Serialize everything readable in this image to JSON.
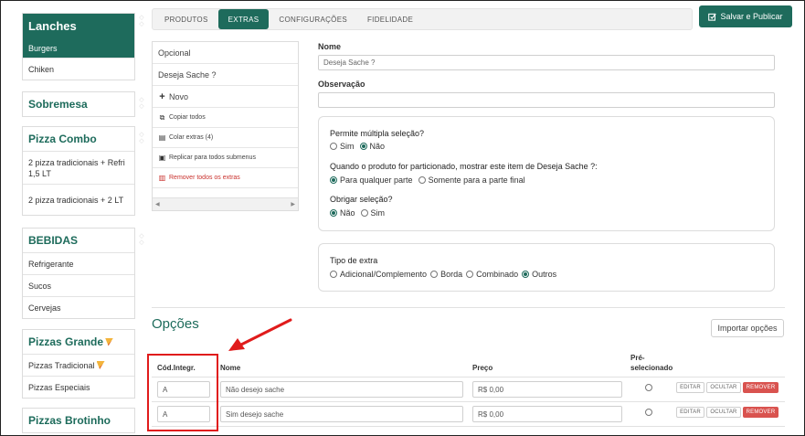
{
  "sidebar": {
    "categories": [
      {
        "name": "Lanches",
        "items": [
          "Burgers",
          "Chiken"
        ]
      },
      {
        "name": "Sobremesa",
        "items": []
      },
      {
        "name": "Pizza Combo",
        "items": [
          "2 pizza tradicionais + Refri 1,5 LT",
          "2 pizza tradicionais + 2 LT"
        ]
      },
      {
        "name": "BEBIDAS",
        "items": [
          "Refrigerante",
          "Sucos",
          "Cervejas"
        ]
      },
      {
        "name": "Pizzas Grande",
        "items": [
          "Pizzas Tradicional",
          "Pizzas Especiais"
        ]
      },
      {
        "name": "Pizzas Brotinho",
        "items": []
      }
    ]
  },
  "tabs": [
    "PRODUTOS",
    "EXTRAS",
    "CONFIGURAÇÕES",
    "FIDELIDADE"
  ],
  "active_tab": "EXTRAS",
  "save_button": "Salvar e Publicar",
  "extras_list": {
    "items": [
      "Opcional",
      "Deseja Sache ?"
    ],
    "actions": {
      "new": "Novo",
      "copy_all": "Copiar todos",
      "paste": "Colar extras (4)",
      "replicate": "Replicar para todos submenus",
      "remove_all": "Remover todos os extras"
    }
  },
  "form": {
    "name_label": "Nome",
    "name_value": "Deseja Sache ?",
    "obs_label": "Observação",
    "obs_value": "",
    "multi_label": "Permite múltipla seleção?",
    "multi_options": [
      "Sim",
      "Não"
    ],
    "multi_selected": "Não",
    "split_label": "Quando o produto for particionado, mostrar este item de Deseja Sache ?:",
    "split_options": [
      "Para qualquer parte",
      "Somente para a parte final"
    ],
    "split_selected": "Para qualquer parte",
    "required_label": "Obrigar seleção?",
    "required_options": [
      "Não",
      "Sim"
    ],
    "required_selected": "Não",
    "type_label": "Tipo de extra",
    "type_options": [
      "Adicional/Complemento",
      "Borda",
      "Combinado",
      "Outros"
    ],
    "type_selected": "Outros"
  },
  "options": {
    "title": "Opções",
    "import_button": "Importar opções",
    "headers": {
      "code": "Cód.Integr.",
      "name": "Nome",
      "price": "Preço",
      "pre1": "Pré-",
      "pre2": "selecionado"
    },
    "rows": [
      {
        "code": "A",
        "name": "Não desejo sache",
        "price": "R$ 0,00"
      },
      {
        "code": "A",
        "name": "Sim desejo sache",
        "price": "R$ 0,00"
      }
    ],
    "row_buttons": {
      "edit": "EDITAR",
      "hide": "OCULTAR",
      "remove": "REMOVER"
    }
  },
  "colors": {
    "primary": "#1e6b5c",
    "danger": "#d9534f",
    "annotation": "#e01b1b"
  }
}
